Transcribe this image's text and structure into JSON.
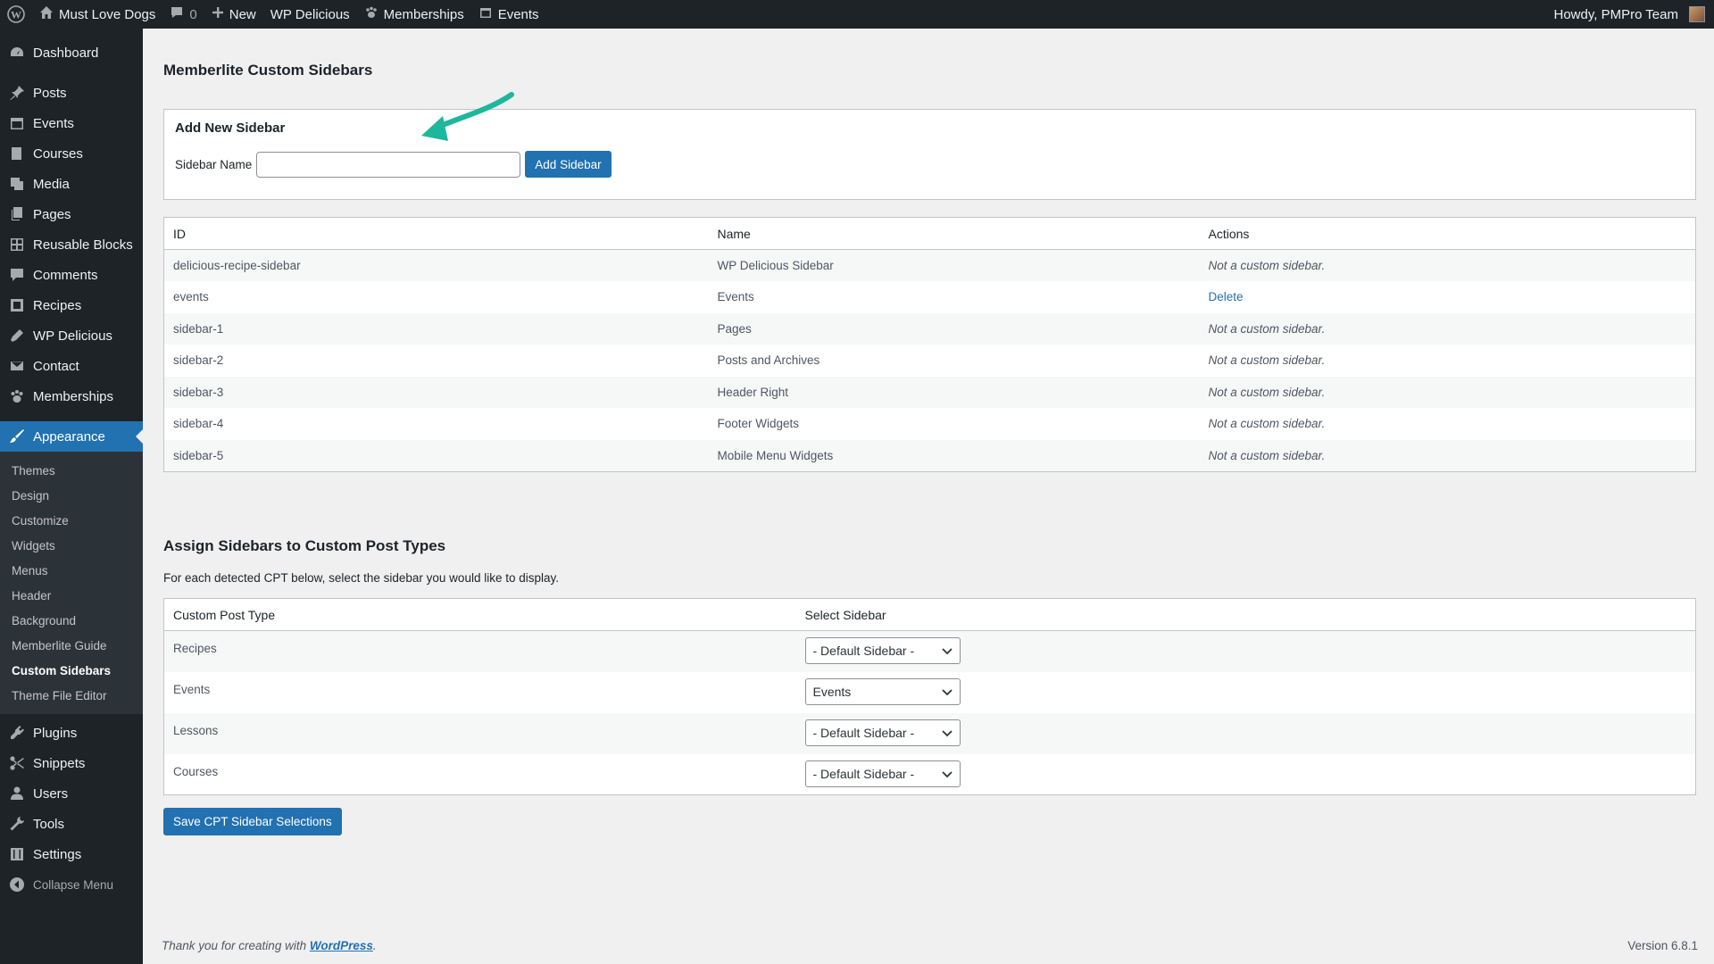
{
  "adminbar": {
    "site_name": "Must Love Dogs",
    "comments_count": "0",
    "new_label": "New",
    "wp_delicious": "WP Delicious",
    "memberships": "Memberships",
    "events": "Events",
    "howdy": "Howdy, PMPro Team"
  },
  "menu": {
    "dashboard": "Dashboard",
    "posts": "Posts",
    "events": "Events",
    "courses": "Courses",
    "media": "Media",
    "pages": "Pages",
    "reusable_blocks": "Reusable Blocks",
    "comments": "Comments",
    "recipes": "Recipes",
    "wp_delicious": "WP Delicious",
    "contact": "Contact",
    "memberships": "Memberships",
    "appearance": "Appearance",
    "sub": [
      "Themes",
      "Design",
      "Customize",
      "Widgets",
      "Menus",
      "Header",
      "Background",
      "Memberlite Guide",
      "Custom Sidebars",
      "Theme File Editor"
    ],
    "plugins": "Plugins",
    "snippets": "Snippets",
    "users": "Users",
    "tools": "Tools",
    "settings": "Settings",
    "collapse": "Collapse Menu"
  },
  "page": {
    "title": "Memberlite Custom Sidebars",
    "add_box": {
      "heading": "Add New Sidebar",
      "field_label": "Sidebar Name",
      "field_value": "",
      "button": "Add Sidebar"
    },
    "sidebars_table": {
      "headers": [
        "ID",
        "Name",
        "Actions"
      ],
      "rows": [
        {
          "id": "delicious-recipe-sidebar",
          "name": "WP Delicious Sidebar",
          "action": "Not a custom sidebar."
        },
        {
          "id": "events",
          "name": "Events",
          "action": "Delete"
        },
        {
          "id": "sidebar-1",
          "name": "Pages",
          "action": "Not a custom sidebar."
        },
        {
          "id": "sidebar-2",
          "name": "Posts and Archives",
          "action": "Not a custom sidebar."
        },
        {
          "id": "sidebar-3",
          "name": "Header Right",
          "action": "Not a custom sidebar."
        },
        {
          "id": "sidebar-4",
          "name": "Footer Widgets",
          "action": "Not a custom sidebar."
        },
        {
          "id": "sidebar-5",
          "name": "Mobile Menu Widgets",
          "action": "Not a custom sidebar."
        }
      ]
    },
    "assign_title": "Assign Sidebars to Custom Post Types",
    "assign_desc": "For each detected CPT below, select the sidebar you would like to display.",
    "cpt_table": {
      "headers": [
        "Custom Post Type",
        "Select Sidebar"
      ],
      "rows": [
        {
          "cpt": "Recipes",
          "selected": "- Default Sidebar -"
        },
        {
          "cpt": "Events",
          "selected": "Events"
        },
        {
          "cpt": "Lessons",
          "selected": "- Default Sidebar -"
        },
        {
          "cpt": "Courses",
          "selected": "- Default Sidebar -"
        }
      ]
    },
    "save_button": "Save CPT Sidebar Selections"
  },
  "footer": {
    "thanks_prefix": "Thank you for creating with ",
    "thanks_link": "WordPress",
    "thanks_suffix": ".",
    "version": "Version 6.8.1"
  },
  "colors": {
    "admin_dark": "#1d2327",
    "accent": "#2271b1",
    "annotation_arrow": "#1fb79b"
  }
}
